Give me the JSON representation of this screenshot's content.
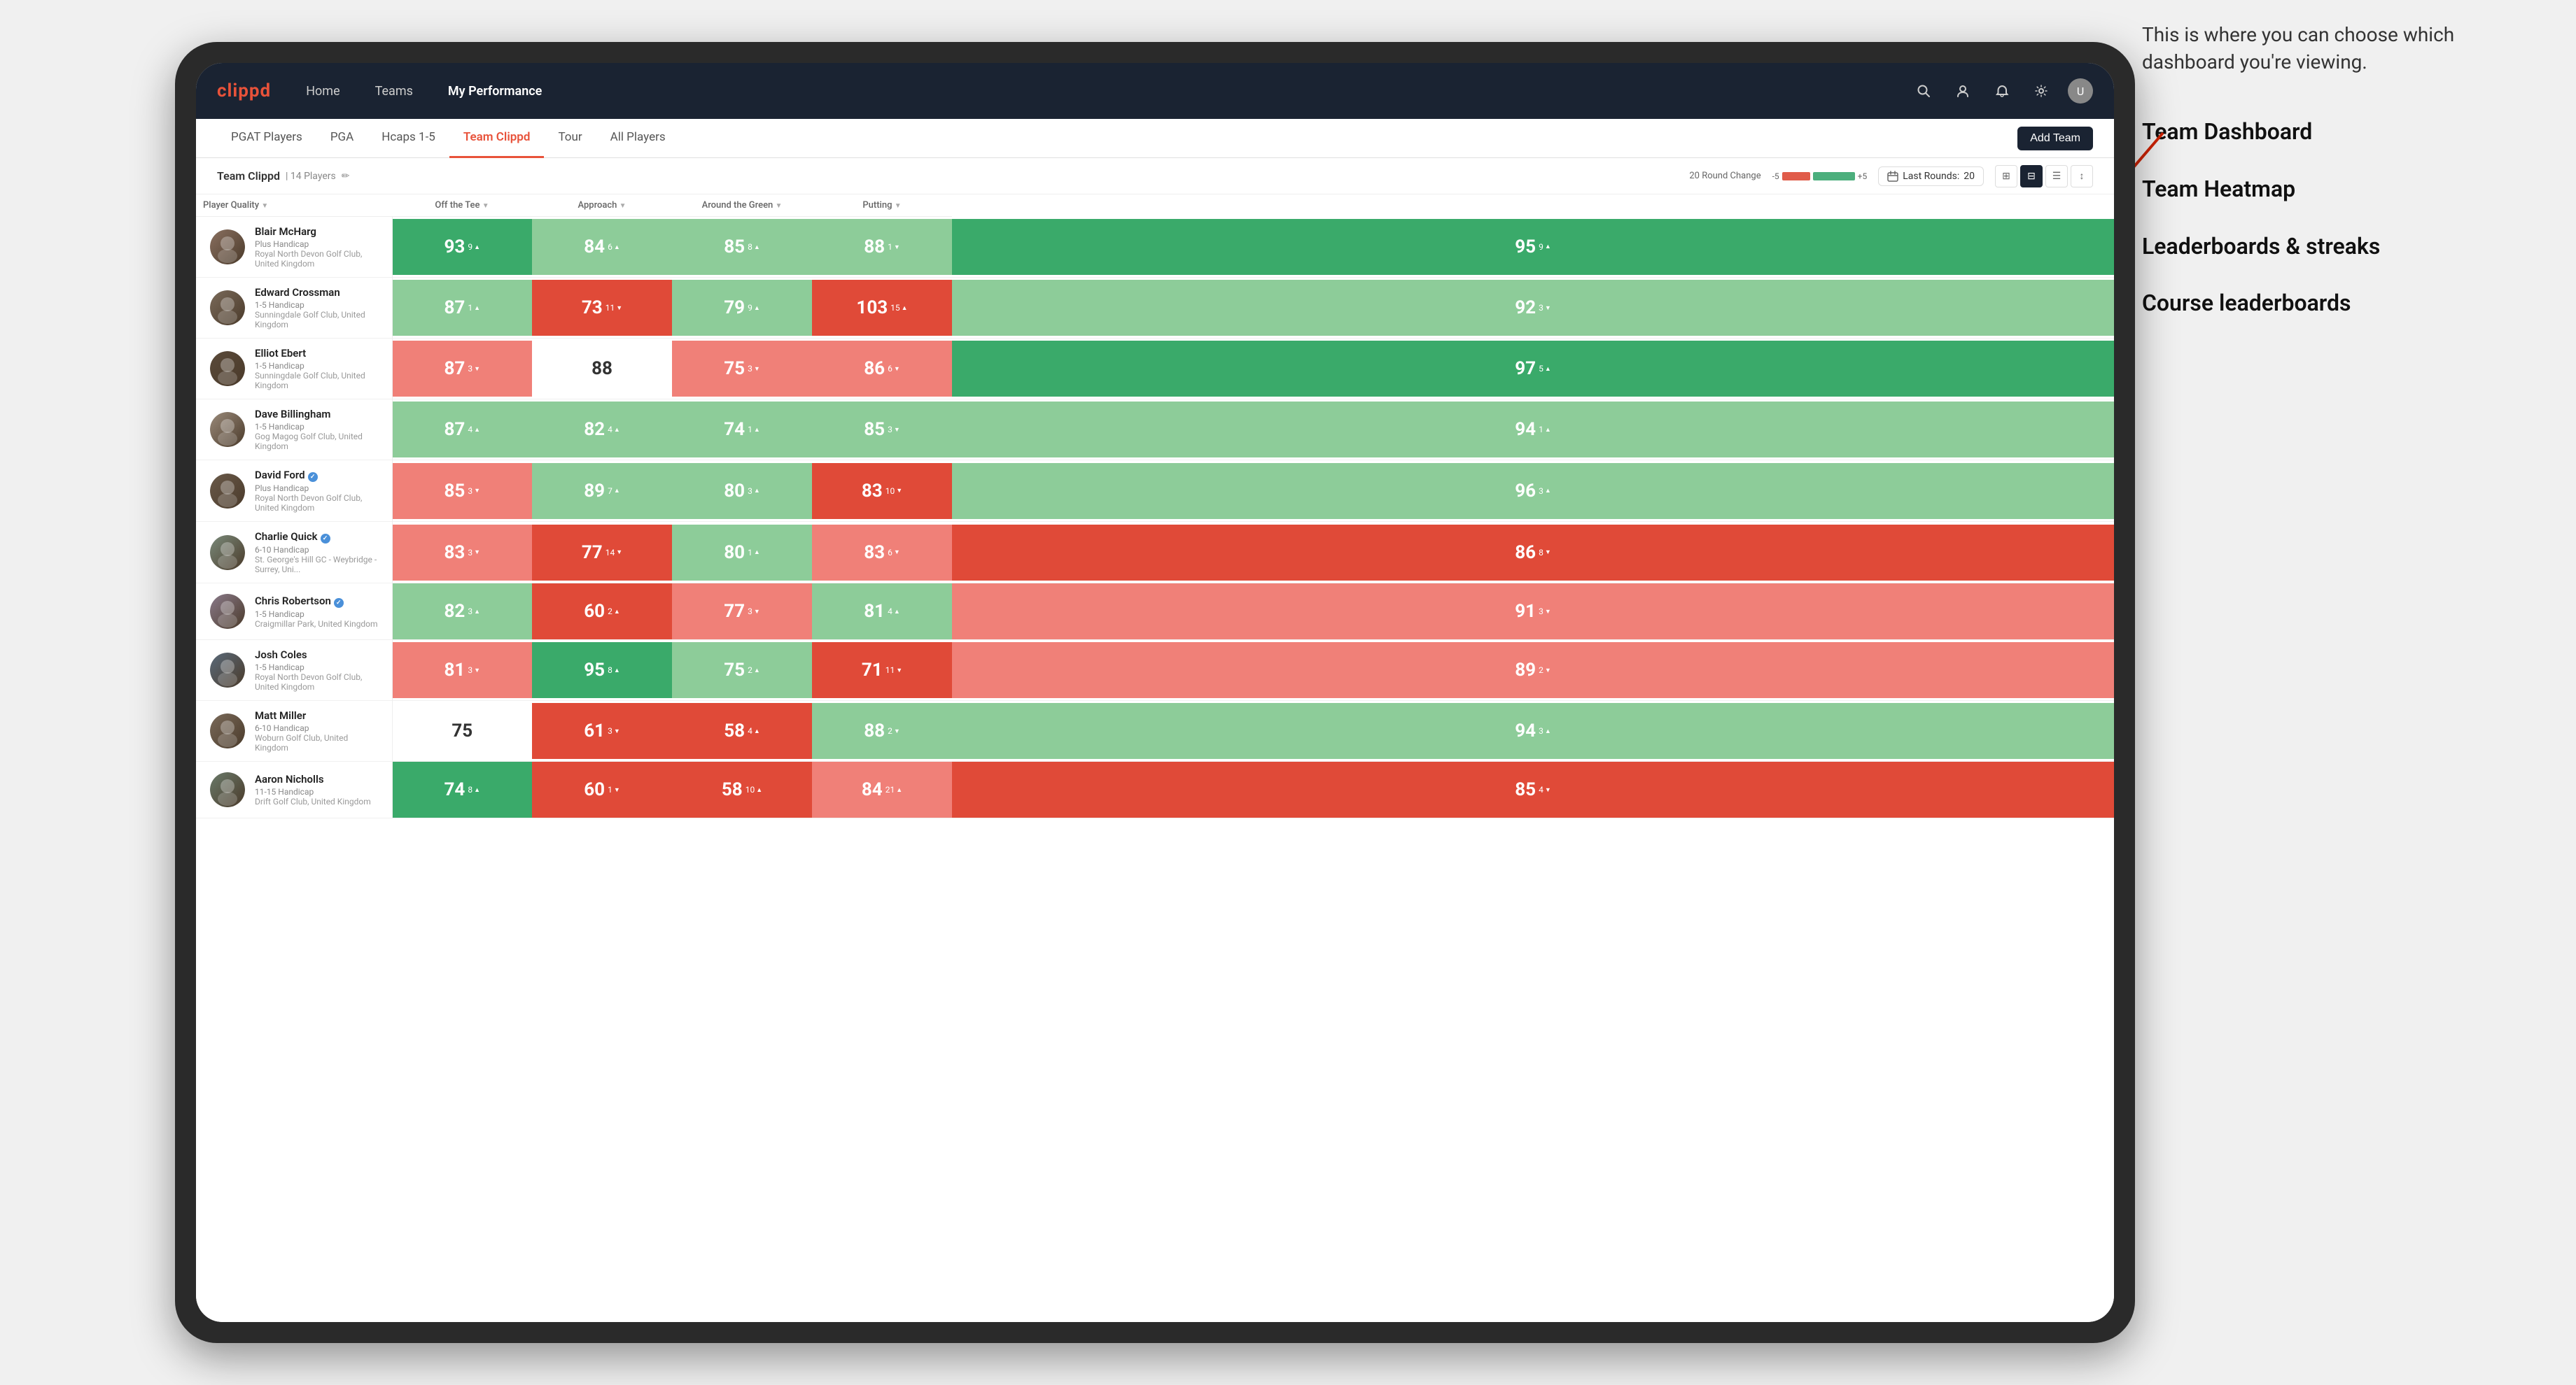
{
  "annotation": {
    "intro_text": "This is where you can choose which dashboard you're viewing.",
    "items": [
      "Team Dashboard",
      "Team Heatmap",
      "Leaderboards & streaks",
      "Course leaderboards"
    ]
  },
  "nav": {
    "logo": "clippd",
    "links": [
      {
        "label": "Home",
        "active": false
      },
      {
        "label": "Teams",
        "active": false
      },
      {
        "label": "My Performance",
        "active": true
      }
    ],
    "icons": [
      "search",
      "person",
      "bell",
      "settings",
      "avatar"
    ]
  },
  "sub_tabs": {
    "tabs": [
      {
        "label": "PGAT Players",
        "active": false
      },
      {
        "label": "PGA",
        "active": false
      },
      {
        "label": "Hcaps 1-5",
        "active": false
      },
      {
        "label": "Team Clippd",
        "active": true
      },
      {
        "label": "Tour",
        "active": false
      },
      {
        "label": "All Players",
        "active": false
      }
    ],
    "add_button": "Add Team"
  },
  "team_info": {
    "name": "Team Clippd",
    "separator": "|",
    "count": "14 Players",
    "round_change_label": "20 Round Change",
    "round_change_min": "-5",
    "round_change_max": "+5",
    "last_rounds_label": "Last Rounds:",
    "last_rounds_value": "20"
  },
  "columns": [
    {
      "label": "Player Quality",
      "has_arrow": true,
      "key": "player_quality"
    },
    {
      "label": "Off the Tee",
      "has_arrow": true,
      "key": "off_tee"
    },
    {
      "label": "Approach",
      "has_arrow": true,
      "key": "approach"
    },
    {
      "label": "Around the Green",
      "has_arrow": true,
      "key": "around_green"
    },
    {
      "label": "Putting",
      "has_arrow": true,
      "key": "putting"
    }
  ],
  "players": [
    {
      "name": "Blair McHarg",
      "badge": "",
      "handicap": "Plus Handicap",
      "club": "Royal North Devon Golf Club, United Kingdom",
      "avatar_color": "#8a7060",
      "player_quality": {
        "value": "93",
        "change": "9",
        "dir": "up",
        "color": "green-dark"
      },
      "off_tee": {
        "value": "84",
        "change": "6",
        "dir": "up",
        "color": "green-light"
      },
      "approach": {
        "value": "85",
        "change": "8",
        "dir": "up",
        "color": "green-light"
      },
      "around_green": {
        "value": "88",
        "change": "1",
        "dir": "down",
        "color": "green-light"
      },
      "putting": {
        "value": "95",
        "change": "9",
        "dir": "up",
        "color": "green-dark"
      }
    },
    {
      "name": "Edward Crossman",
      "badge": "",
      "handicap": "1-5 Handicap",
      "club": "Sunningdale Golf Club, United Kingdom",
      "avatar_color": "#7a6a5a",
      "player_quality": {
        "value": "87",
        "change": "1",
        "dir": "up",
        "color": "green-light"
      },
      "off_tee": {
        "value": "73",
        "change": "11",
        "dir": "down",
        "color": "red-dark"
      },
      "approach": {
        "value": "79",
        "change": "9",
        "dir": "up",
        "color": "green-light"
      },
      "around_green": {
        "value": "103",
        "change": "15",
        "dir": "up",
        "color": "red-dark"
      },
      "putting": {
        "value": "92",
        "change": "3",
        "dir": "down",
        "color": "green-light"
      }
    },
    {
      "name": "Elliot Ebert",
      "badge": "",
      "handicap": "1-5 Handicap",
      "club": "Sunningdale Golf Club, United Kingdom",
      "avatar_color": "#5a4a3a",
      "player_quality": {
        "value": "87",
        "change": "3",
        "dir": "down",
        "color": "red-light"
      },
      "off_tee": {
        "value": "88",
        "change": "",
        "dir": "",
        "color": "white"
      },
      "approach": {
        "value": "75",
        "change": "3",
        "dir": "down",
        "color": "red-light"
      },
      "around_green": {
        "value": "86",
        "change": "6",
        "dir": "down",
        "color": "red-light"
      },
      "putting": {
        "value": "97",
        "change": "5",
        "dir": "up",
        "color": "green-dark"
      }
    },
    {
      "name": "Dave Billingham",
      "badge": "",
      "handicap": "1-5 Handicap",
      "club": "Gog Magog Golf Club, United Kingdom",
      "avatar_color": "#9a8a7a",
      "player_quality": {
        "value": "87",
        "change": "4",
        "dir": "up",
        "color": "green-light"
      },
      "off_tee": {
        "value": "82",
        "change": "4",
        "dir": "up",
        "color": "green-light"
      },
      "approach": {
        "value": "74",
        "change": "1",
        "dir": "up",
        "color": "green-light"
      },
      "around_green": {
        "value": "85",
        "change": "3",
        "dir": "down",
        "color": "green-light"
      },
      "putting": {
        "value": "94",
        "change": "1",
        "dir": "up",
        "color": "green-light"
      }
    },
    {
      "name": "David Ford",
      "badge": "verified",
      "handicap": "Plus Handicap",
      "club": "Royal North Devon Golf Club, United Kingdom",
      "avatar_color": "#6a5a4a",
      "player_quality": {
        "value": "85",
        "change": "3",
        "dir": "down",
        "color": "red-light"
      },
      "off_tee": {
        "value": "89",
        "change": "7",
        "dir": "up",
        "color": "green-light"
      },
      "approach": {
        "value": "80",
        "change": "3",
        "dir": "up",
        "color": "green-light"
      },
      "around_green": {
        "value": "83",
        "change": "10",
        "dir": "down",
        "color": "red-dark"
      },
      "putting": {
        "value": "96",
        "change": "3",
        "dir": "up",
        "color": "green-light"
      }
    },
    {
      "name": "Charlie Quick",
      "badge": "verified",
      "handicap": "6-10 Handicap",
      "club": "St. George's Hill GC - Weybridge - Surrey, Uni...",
      "avatar_color": "#7a8a7a",
      "player_quality": {
        "value": "83",
        "change": "3",
        "dir": "down",
        "color": "red-light"
      },
      "off_tee": {
        "value": "77",
        "change": "14",
        "dir": "down",
        "color": "red-dark"
      },
      "approach": {
        "value": "80",
        "change": "1",
        "dir": "up",
        "color": "green-light"
      },
      "around_green": {
        "value": "83",
        "change": "6",
        "dir": "down",
        "color": "red-light"
      },
      "putting": {
        "value": "86",
        "change": "8",
        "dir": "down",
        "color": "red-dark"
      }
    },
    {
      "name": "Chris Robertson",
      "badge": "verified",
      "handicap": "1-5 Handicap",
      "club": "Craigmillar Park, United Kingdom",
      "avatar_color": "#8a7a8a",
      "player_quality": {
        "value": "82",
        "change": "3",
        "dir": "up",
        "color": "green-light"
      },
      "off_tee": {
        "value": "60",
        "change": "2",
        "dir": "up",
        "color": "red-dark"
      },
      "approach": {
        "value": "77",
        "change": "3",
        "dir": "down",
        "color": "red-light"
      },
      "around_green": {
        "value": "81",
        "change": "4",
        "dir": "up",
        "color": "green-light"
      },
      "putting": {
        "value": "91",
        "change": "3",
        "dir": "down",
        "color": "red-light"
      }
    },
    {
      "name": "Josh Coles",
      "badge": "",
      "handicap": "1-5 Handicap",
      "club": "Royal North Devon Golf Club, United Kingdom",
      "avatar_color": "#5a6a7a",
      "player_quality": {
        "value": "81",
        "change": "3",
        "dir": "down",
        "color": "red-light"
      },
      "off_tee": {
        "value": "95",
        "change": "8",
        "dir": "up",
        "color": "green-dark"
      },
      "approach": {
        "value": "75",
        "change": "2",
        "dir": "up",
        "color": "green-light"
      },
      "around_green": {
        "value": "71",
        "change": "11",
        "dir": "down",
        "color": "red-dark"
      },
      "putting": {
        "value": "89",
        "change": "2",
        "dir": "down",
        "color": "red-light"
      }
    },
    {
      "name": "Matt Miller",
      "badge": "",
      "handicap": "6-10 Handicap",
      "club": "Woburn Golf Club, United Kingdom",
      "avatar_color": "#7a6a5a",
      "player_quality": {
        "value": "75",
        "change": "",
        "dir": "",
        "color": "white"
      },
      "off_tee": {
        "value": "61",
        "change": "3",
        "dir": "down",
        "color": "red-dark"
      },
      "approach": {
        "value": "58",
        "change": "4",
        "dir": "up",
        "color": "red-dark"
      },
      "around_green": {
        "value": "88",
        "change": "2",
        "dir": "down",
        "color": "green-light"
      },
      "putting": {
        "value": "94",
        "change": "3",
        "dir": "up",
        "color": "green-light"
      }
    },
    {
      "name": "Aaron Nicholls",
      "badge": "",
      "handicap": "11-15 Handicap",
      "club": "Drift Golf Club, United Kingdom",
      "avatar_color": "#6a7a6a",
      "player_quality": {
        "value": "74",
        "change": "8",
        "dir": "up",
        "color": "green-dark"
      },
      "off_tee": {
        "value": "60",
        "change": "1",
        "dir": "down",
        "color": "red-dark"
      },
      "approach": {
        "value": "58",
        "change": "10",
        "dir": "up",
        "color": "red-dark"
      },
      "around_green": {
        "value": "84",
        "change": "21",
        "dir": "up",
        "color": "red-light"
      },
      "putting": {
        "value": "85",
        "change": "4",
        "dir": "down",
        "color": "red-dark"
      }
    }
  ]
}
